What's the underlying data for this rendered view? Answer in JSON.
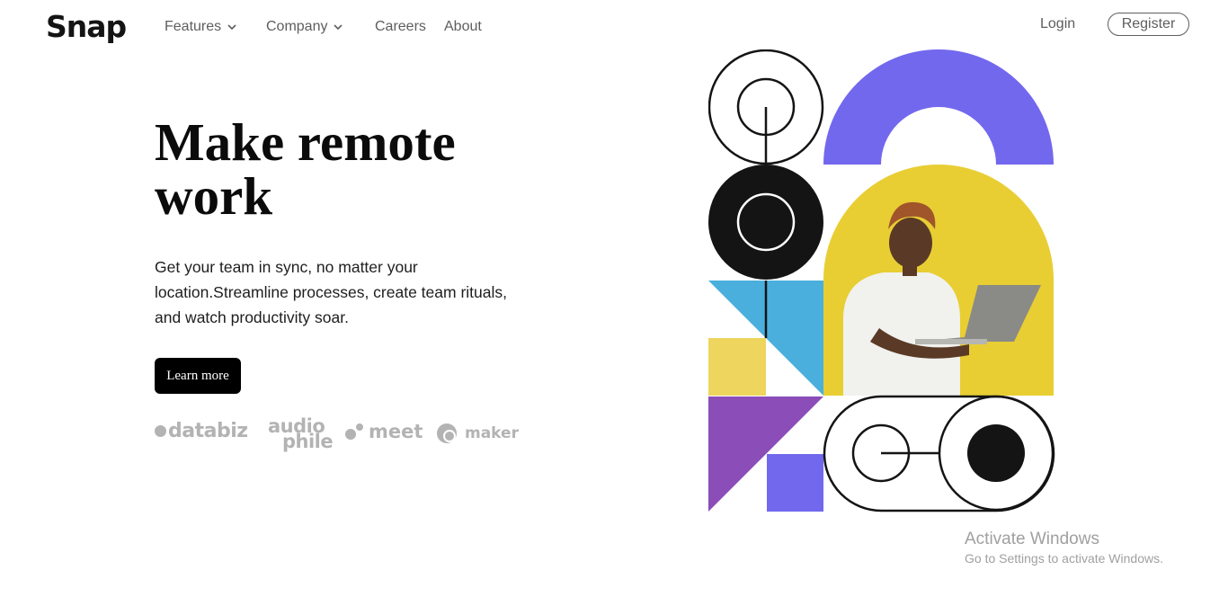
{
  "brand": {
    "logo": "Snap"
  },
  "nav": {
    "items": [
      {
        "label": "Features",
        "dropdown": true
      },
      {
        "label": "Company",
        "dropdown": true
      },
      {
        "label": "Careers",
        "dropdown": false
      },
      {
        "label": "About",
        "dropdown": false
      }
    ],
    "login_label": "Login",
    "register_label": "Register"
  },
  "hero": {
    "title": "Make remote work",
    "description": "Get your team in sync, no matter your location.Streamline processes, create team rituals, and watch productivity soar.",
    "cta_label": "Learn more"
  },
  "clients": {
    "databiz": "databiz",
    "audiophile_line1": "audio",
    "audiophile_line2": "phile",
    "meet": "meet",
    "maker": "maker"
  },
  "colors": {
    "accent_purple": "#7268EE",
    "yellow": "#E8CE33",
    "blue": "#4AAFDC",
    "violet": "#8B4DB8",
    "black": "#141414"
  },
  "watermark": {
    "title": "Activate Windows",
    "subtitle": "Go to Settings to activate Windows."
  }
}
